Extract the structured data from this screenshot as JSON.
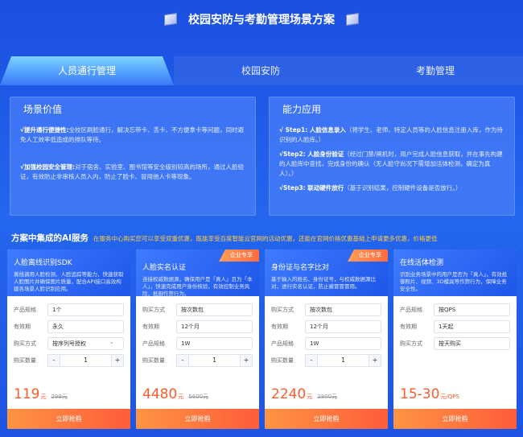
{
  "header": {
    "title": "校园安防与考勤管理场景方案"
  },
  "tabs": [
    "人员通行管理",
    "校园安防",
    "考勤管理"
  ],
  "panels": {
    "value": {
      "title": "场景价值",
      "item1_head": "√提升通行便捷性:",
      "item1_body": "全校区刷脸通行，解决忘带卡、丢卡、不方便拿卡等问题，同时避免人工效率低造成的排队等待。",
      "item2_head": "√加强校园安全管理:",
      "item2_body": "对于宿舍、实验室、图书馆等安全级别较高的场所，通过人脸验证，有效防止非审核人员入内，防止了脸卡、冒用他人卡等现象。"
    },
    "ability": {
      "title": "能力应用",
      "step1_head": "√ Step1:  人脸信息录入",
      "step1_body": "（将学生、老师、特定人员等的人脸信息注册入库，作为待识别的人脸库。）",
      "step2_head": "√Step2:  人脸身份验证",
      "step2_body": "（经过门禁/闸机时，用户完成人脸信息获取，并在事先构建的人脸库中查找，完成身份的确认（无人脸守尚况下需增加活体检测，确定为真人）。）",
      "step3_head": "√Step3:  联动硬件放行",
      "step3_body": "（基于识别结果，控制硬件设备是否放行。）"
    }
  },
  "section": {
    "title": "方案中集成的AI服务",
    "note": "在服务中心购买您可以享受双重优惠，既能享受百度智能云官网的活动优惠，还能在官网价格优惠基础上申请更多优惠，价格更低"
  },
  "cards": [
    {
      "title": "人脸离线识别SDK",
      "desc": "离线调用人脸检测、人脸追踪等能力，快速获取人脸图片并确保图片质量，配合API接口高效构建各场景人脸识别应用。",
      "tag": "",
      "rows": [
        {
          "label": "产品规格",
          "value": "1个"
        },
        {
          "label": "有效期",
          "value": "永久"
        },
        {
          "label": "购买方式",
          "value": "按序列号授权"
        }
      ],
      "qty_label": "购买数量",
      "minus": "-",
      "qty": "1",
      "plus": "+",
      "price": "119",
      "unit": "元",
      "old_price": "299元",
      "buy": "立即抢购"
    },
    {
      "title": "人脸实名认证",
      "desc": "连接权威数据源，确保用户是「真人」且为「本人」，快速完成用户身份核验，有效控制业务风险，抵御作弊行为。",
      "tag": "企业专享",
      "rows": [
        {
          "label": "购买方式",
          "value": "按次数包"
        },
        {
          "label": "有效期",
          "value": "12个月"
        },
        {
          "label": "产品规格",
          "value": "1W"
        }
      ],
      "qty_label": "购买数量",
      "minus": "-",
      "qty": "1",
      "plus": "+",
      "price": "4480",
      "unit": "元",
      "old_price": "5600元",
      "buy": "立即抢购"
    },
    {
      "title": "身份证与名字比对",
      "desc": "基于输入的姓名、身份证号，与权威数据源比对，进行实名认证，防止被冒冒冒用。",
      "tag": "企业专享",
      "rows": [
        {
          "label": "购买方式",
          "value": "按次数包"
        },
        {
          "label": "有效期",
          "value": "12个月"
        },
        {
          "label": "产品规格",
          "value": "1W"
        }
      ],
      "qty_label": "购买数量",
      "minus": "-",
      "qty": "1",
      "plus": "+",
      "price": "2240",
      "unit": "元",
      "old_price": "2800元",
      "buy": "立即抢购"
    },
    {
      "title": "在线活体检测",
      "desc": "识别业务场景中的用户是否为「真人」，有效抵御照片、视频、3D模具等作弊行为，保障业务安全性。",
      "tag": "",
      "rows": [
        {
          "label": "产品规格",
          "value": "按QPS"
        },
        {
          "label": "有效期",
          "value": "1天起"
        },
        {
          "label": "购买方式",
          "value": "按天购买"
        }
      ],
      "qty_label": "",
      "minus": "",
      "qty": "",
      "plus": "",
      "price": "15-30",
      "unit": "元/QPS",
      "old_price": "",
      "buy": "立即抢购"
    }
  ]
}
